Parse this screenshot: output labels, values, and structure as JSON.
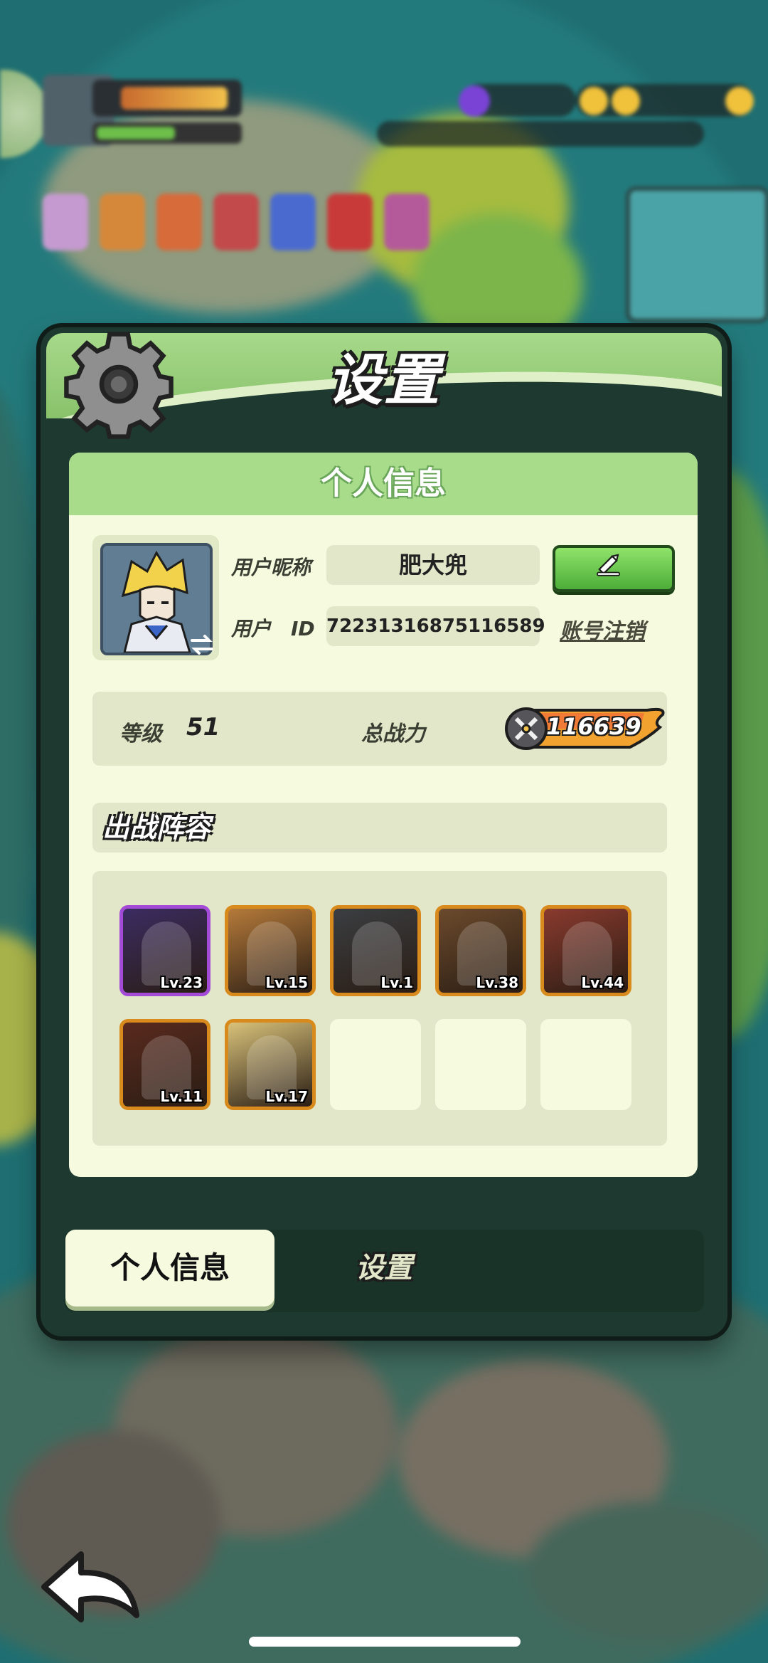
{
  "dialog": {
    "title": "设置",
    "header_icon": "gear-icon"
  },
  "profile_card": {
    "header": "个人信息",
    "nickname_label": "用户昵称",
    "nickname_value": "肥大兜",
    "edit_icon": "pencil-icon",
    "user_id_label": "用户　ID",
    "user_id_value": "72231316875116589",
    "logout_label": "账号注销",
    "avatar_swap_icon": "swap-icon"
  },
  "stats": {
    "level_label": "等级",
    "level_value": "51",
    "power_label": "总战力",
    "power_value": "116639",
    "power_icon": "crossed-swords-icon"
  },
  "lineup": {
    "title": "出战阵容",
    "heroes": [
      {
        "level": "Lv.23",
        "frame": "purple",
        "color": "#3b2c62"
      },
      {
        "level": "Lv.15",
        "frame": "orange",
        "color": "#b57a3a"
      },
      {
        "level": "Lv.1",
        "frame": "orange",
        "color": "#3b3e42"
      },
      {
        "level": "Lv.38",
        "frame": "orange",
        "color": "#6b4a2c"
      },
      {
        "level": "Lv.44",
        "frame": "orange",
        "color": "#8a3a2e"
      },
      {
        "level": "Lv.11",
        "frame": "orange",
        "color": "#5a2a1e"
      },
      {
        "level": "Lv.17",
        "frame": "orange",
        "color": "#d9c27a"
      }
    ],
    "empty_slots": 3
  },
  "tabs": [
    {
      "label": "个人信息",
      "active": true
    },
    {
      "label": "设置",
      "active": false
    }
  ],
  "navigation": {
    "back_icon": "back-arrow-icon"
  },
  "colors": {
    "header_green": "#a7d98a",
    "card_bg": "#f6fbe0",
    "field_bg": "#e2e7c9",
    "edit_green": "#4cad38",
    "power_orange": "#f28a2e",
    "dialog_dark": "#1e3a30"
  }
}
